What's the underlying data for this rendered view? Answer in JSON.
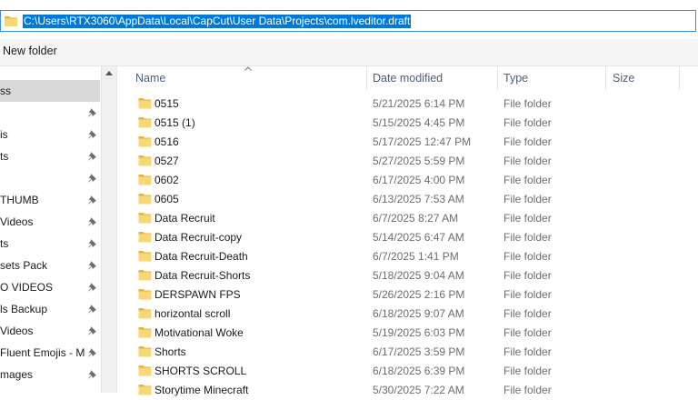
{
  "address": {
    "path": "C:\\Users\\RTX3060\\AppData\\Local\\CapCut\\User Data\\Projects\\com.lveditor.draft"
  },
  "toolbar": {
    "new_folder_label": "New folder"
  },
  "nav": {
    "items": [
      {
        "label": "ss",
        "pinned": false,
        "selected": true
      },
      {
        "label": "",
        "pinned": true
      },
      {
        "label": "is",
        "pinned": true
      },
      {
        "label": "ts",
        "pinned": true
      },
      {
        "label": "",
        "pinned": true
      },
      {
        "label": " THUMB",
        "pinned": true
      },
      {
        "label": " Videos",
        "pinned": true
      },
      {
        "label": "ts",
        "pinned": true
      },
      {
        "label": "sets Pack",
        "pinned": true
      },
      {
        "label": "O VIDEOS",
        "pinned": true
      },
      {
        "label": "ls Backup",
        "pinned": true
      },
      {
        "label": "Videos",
        "pinned": true
      },
      {
        "label": " Fluent Emojis - M",
        "pinned": true
      },
      {
        "label": "mages",
        "pinned": true
      }
    ]
  },
  "columns": {
    "name": "Name",
    "date": "Date modified",
    "type": "Type",
    "size": "Size"
  },
  "files": [
    {
      "name": "0515",
      "date": "5/21/2025 6:14 PM",
      "type": "File folder"
    },
    {
      "name": "0515 (1)",
      "date": "5/15/2025 4:45 PM",
      "type": "File folder"
    },
    {
      "name": "0516",
      "date": "5/17/2025 12:47 PM",
      "type": "File folder"
    },
    {
      "name": "0527",
      "date": "5/27/2025 5:59 PM",
      "type": "File folder"
    },
    {
      "name": "0602",
      "date": "6/17/2025 4:00 PM",
      "type": "File folder"
    },
    {
      "name": "0605",
      "date": "6/13/2025 7:53 AM",
      "type": "File folder"
    },
    {
      "name": "Data Recruit",
      "date": "6/7/2025 8:27 AM",
      "type": "File folder"
    },
    {
      "name": "Data Recruit-copy",
      "date": "5/14/2025 6:47 AM",
      "type": "File folder"
    },
    {
      "name": "Data Recruit-Death",
      "date": "6/7/2025 1:41 PM",
      "type": "File folder"
    },
    {
      "name": "Data Recruit-Shorts",
      "date": "5/18/2025 9:04 AM",
      "type": "File folder"
    },
    {
      "name": "DERSPAWN FPS",
      "date": "5/26/2025 2:16 PM",
      "type": "File folder"
    },
    {
      "name": "horizontal scroll",
      "date": "6/18/2025 9:07 AM",
      "type": "File folder"
    },
    {
      "name": "Motivational Woke",
      "date": "5/19/2025 6:03 PM",
      "type": "File folder"
    },
    {
      "name": "Shorts",
      "date": "6/17/2025 3:59 PM",
      "type": "File folder"
    },
    {
      "name": "SHORTS SCROLL",
      "date": "6/18/2025 6:39 PM",
      "type": "File folder"
    },
    {
      "name": "Storytime Minecraft",
      "date": "5/30/2025 7:22 AM",
      "type": "File folder"
    }
  ],
  "colors": {
    "accent": "#0078d7",
    "folder": "#f8d775",
    "folder_dark": "#e0b440"
  }
}
